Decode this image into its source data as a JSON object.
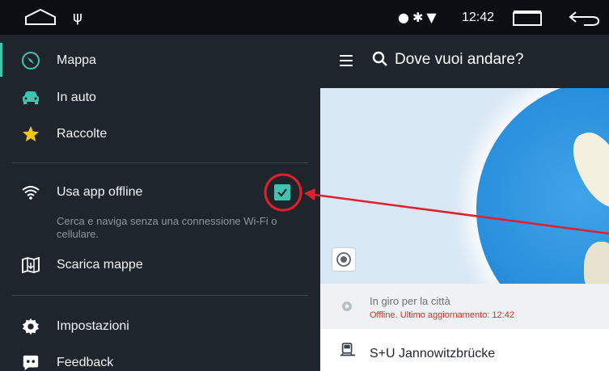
{
  "status_bar": {
    "time": "12:42",
    "icons": [
      "home-outline-icon",
      "usb-icon",
      "location-icon",
      "bluetooth-icon",
      "wifi-icon",
      "recents-icon",
      "back-icon"
    ]
  },
  "drawer": {
    "items": [
      {
        "label": "Mappa",
        "icon": "compass-icon",
        "active": true
      },
      {
        "label": "In auto",
        "icon": "car-icon"
      },
      {
        "label": "Raccolte",
        "icon": "star-icon"
      }
    ],
    "offline": {
      "label": "Usa app offline",
      "description": "Cerca e naviga senza una connessione Wi-Fi o cellulare.",
      "checked": true
    },
    "download": {
      "label": "Scarica mappe"
    },
    "settings": {
      "label": "Impostazioni"
    },
    "feedback": {
      "label": "Feedback"
    }
  },
  "main": {
    "search_placeholder": "Dove vuoi andare?",
    "suggestion": {
      "title": "In giro per la città",
      "subtitle": "Offline. Ultimo aggiornamento: 12:42"
    },
    "place": {
      "title": "S+U Jannowitzbrücke"
    }
  },
  "colors": {
    "accent": "#40c4b0",
    "drawer_bg": "#1f252c",
    "annotation": "#e0202e",
    "offline_text": "#d32f2f"
  }
}
